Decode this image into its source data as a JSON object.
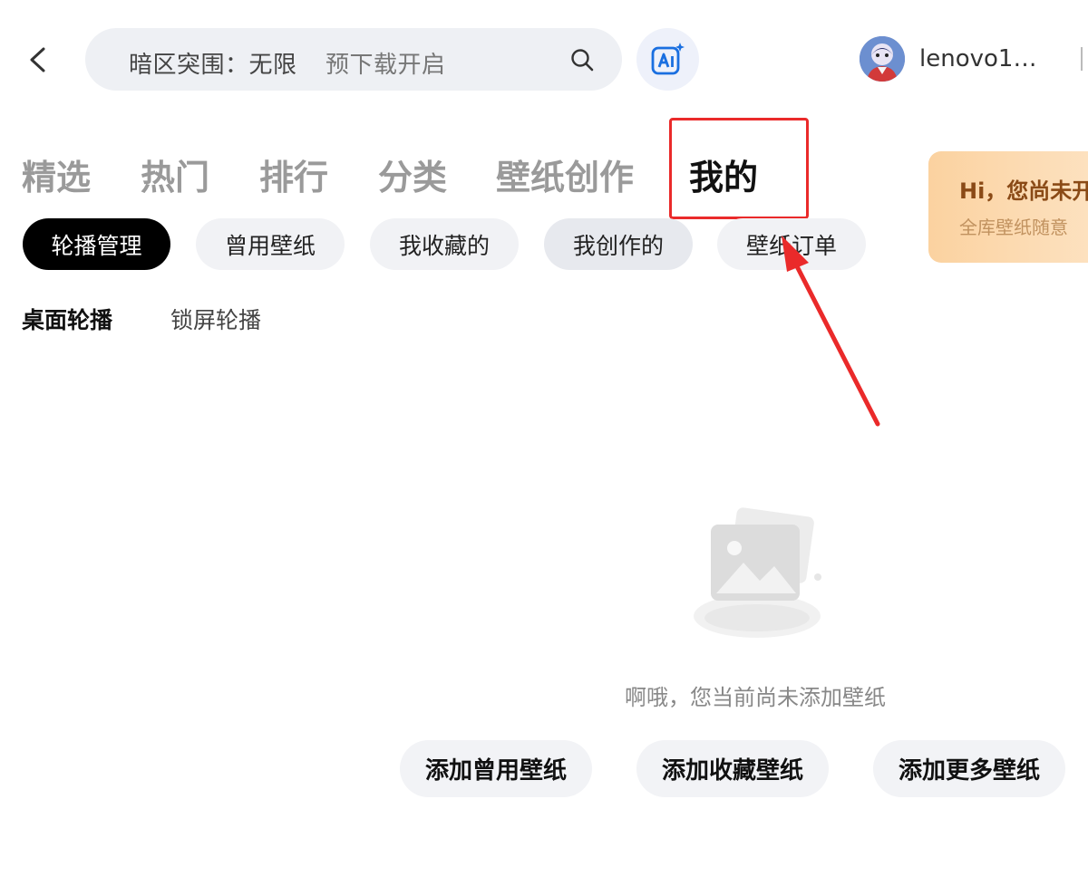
{
  "header": {
    "search": {
      "hot_term": "暗区突围：无限",
      "sub_term": "预下载开启"
    },
    "username": "lenovo1…"
  },
  "main_tabs": [
    {
      "label": "精选"
    },
    {
      "label": "热门"
    },
    {
      "label": "排行"
    },
    {
      "label": "分类"
    },
    {
      "label": "壁纸创作"
    },
    {
      "label": "我的"
    }
  ],
  "promo": {
    "title": "Hi，您尚未开",
    "subtitle": "全库壁纸随意"
  },
  "sub_tabs": [
    {
      "label": "轮播管理"
    },
    {
      "label": "曾用壁纸"
    },
    {
      "label": "我收藏的"
    },
    {
      "label": "我创作的"
    },
    {
      "label": "壁纸订单"
    }
  ],
  "carousel_tabs": [
    {
      "label": "桌面轮播"
    },
    {
      "label": "锁屏轮播"
    }
  ],
  "empty_state": {
    "message": "啊哦，您当前尚未添加壁纸"
  },
  "actions": [
    {
      "label": "添加曾用壁纸"
    },
    {
      "label": "添加收藏壁纸"
    },
    {
      "label": "添加更多壁纸"
    }
  ],
  "colors": {
    "annotation_red": "#ea2a2a",
    "active_chip": "#000000",
    "ai_blue": "#1a6fe0"
  }
}
